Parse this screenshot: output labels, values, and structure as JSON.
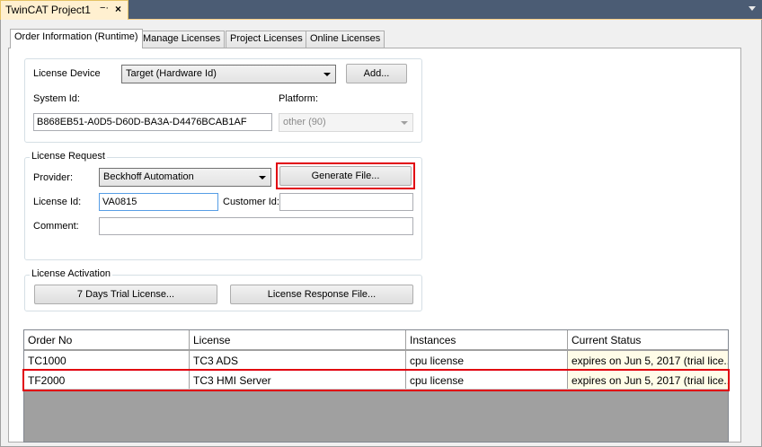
{
  "doc_tab": {
    "title": "TwinCAT Project1",
    "pin_glyph": "−·",
    "close_glyph": "×"
  },
  "tabs": [
    {
      "label": "Order Information (Runtime)",
      "active": true
    },
    {
      "label": "Manage Licenses",
      "active": false
    },
    {
      "label": "Project Licenses",
      "active": false
    },
    {
      "label": "Online Licenses",
      "active": false
    }
  ],
  "device": {
    "license_device_label": "License Device",
    "license_device_value": "Target (Hardware Id)",
    "add_button": "Add...",
    "system_id_label": "System Id:",
    "system_id_value": "B868EB51-A0D5-D60D-BA3A-D4476BCAB1AF",
    "platform_label": "Platform:",
    "platform_value": "other (90)"
  },
  "request": {
    "group_label": "License Request",
    "provider_label": "Provider:",
    "provider_value": "Beckhoff Automation",
    "generate_button": "Generate File...",
    "license_id_label": "License Id:",
    "license_id_value": "VA0815",
    "customer_id_label": "Customer Id:",
    "customer_id_value": "",
    "comment_label": "Comment:",
    "comment_value": ""
  },
  "activation": {
    "group_label": "License Activation",
    "trial_button": "7 Days Trial License...",
    "response_button": "License Response File..."
  },
  "grid": {
    "columns": [
      "Order No",
      "License",
      "Instances",
      "Current Status"
    ],
    "rows": [
      {
        "order_no": "TC1000",
        "license": "TC3 ADS",
        "instances": "cpu license",
        "status": "expires on Jun 5, 2017 (trial lice..."
      },
      {
        "order_no": "TF2000",
        "license": "TC3 HMI Server",
        "instances": "cpu license",
        "status": "expires on Jun 5, 2017 (trial lice..."
      }
    ]
  },
  "colors": {
    "highlight": "#e1000f",
    "status_cell": "#fffce8",
    "doc_tab": "#fff0d0"
  }
}
